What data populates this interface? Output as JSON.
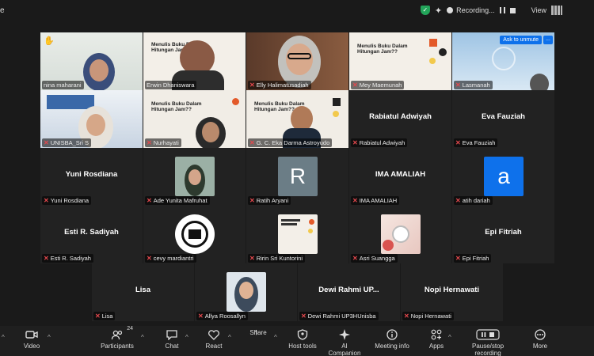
{
  "topbar": {
    "left_fragment": "e",
    "recording_label": "Recording...",
    "view_label": "View"
  },
  "colors": {
    "active_speaker": "#6ed46e",
    "mic_muted": "#e5484d",
    "share_green": "#23a55a",
    "accent_blue": "#0e71eb",
    "avatar_gray": "#6b7d86"
  },
  "tiles": [
    {
      "name": "nina maharani",
      "display": ""
    },
    {
      "name": "Erwin Dhaniswara",
      "display": ""
    },
    {
      "name": "Elly Halimatusadiah",
      "display": ""
    },
    {
      "name": "Mey Maemunah",
      "display": ""
    },
    {
      "name": "Lasmanah",
      "display": ""
    },
    {
      "name": "UNISBA_Sri S",
      "display": ""
    },
    {
      "name": "Nurhayati",
      "display": ""
    },
    {
      "name": "G. C. Eka Darma Astroyudo",
      "display": ""
    },
    {
      "name": "Rabiatul Adwiyah",
      "display": "Rabiatul Adwiyah"
    },
    {
      "name": "Eva Fauziah",
      "display": "Eva Fauziah"
    },
    {
      "name": "Yuni Rosdiana",
      "display": "Yuni Rosdiana"
    },
    {
      "name": "Ade Yunita Mafruhat",
      "display": ""
    },
    {
      "name": "Ratih Aryani",
      "display": "",
      "avatar_letter": "R"
    },
    {
      "name": "IMA AMALIAH",
      "display": "IMA AMALIAH"
    },
    {
      "name": "atih dariah",
      "display": "",
      "avatar_letter": "a"
    },
    {
      "name": "Esti R. Sadiyah",
      "display": "Esti R. Sadiyah"
    },
    {
      "name": "cevy mardiantri",
      "display": ""
    },
    {
      "name": "Ririn Sri Kuntorini",
      "display": ""
    },
    {
      "name": "Asri Suangga",
      "display": ""
    },
    {
      "name": "Epi Fitriah",
      "display": "Epi Fitriah"
    },
    {
      "name": "Lisa",
      "display": "Lisa"
    },
    {
      "name": "Allya Roosallyn",
      "display": ""
    },
    {
      "name": "Dewi Rahmi UP3HUnisba",
      "display": "Dewi Rahmi UP..."
    },
    {
      "name": "Nopi Hernawati",
      "display": "Nopi Hernawati"
    }
  ],
  "poster": {
    "title_line1": "Menulis Buku Dalam",
    "title_line2": "Hitungan Jam??"
  },
  "overlay": {
    "ask_unmute": "Ask to unmute",
    "more": "..."
  },
  "toolbar": {
    "video": "Video",
    "participants": "Participants",
    "participants_count": "24",
    "chat": "Chat",
    "react": "React",
    "share": "Share",
    "host_tools": "Host tools",
    "ai_companion": "AI Companion",
    "meeting_info": "Meeting info",
    "apps": "Apps",
    "pause_recording": "Pause/stop recording",
    "more": "More"
  }
}
